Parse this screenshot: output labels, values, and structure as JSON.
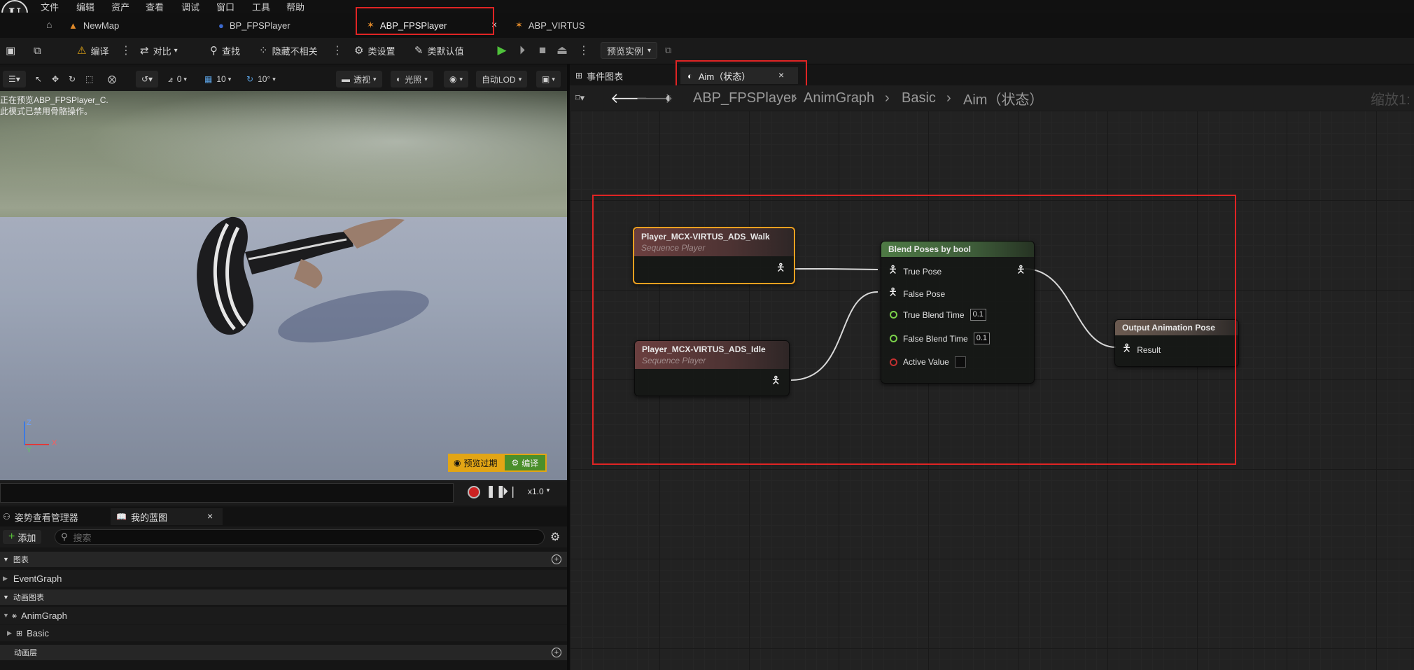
{
  "menu": [
    "文件",
    "编辑",
    "资产",
    "查看",
    "调试",
    "窗口",
    "工具",
    "帮助"
  ],
  "doc_tabs": [
    {
      "label": "NewMap"
    },
    {
      "label": "BP_FPSPlayer"
    },
    {
      "label": "ABP_FPSPlayer",
      "active": true
    },
    {
      "label": "ABP_VIRTUS"
    }
  ],
  "toolbar": {
    "compile": "编译",
    "diff": "对比",
    "find": "查找",
    "hide_unrelated": "隐藏不相关",
    "class_settings": "类设置",
    "class_defaults": "类默认值",
    "preview_instance": "预览实例"
  },
  "viewport_toolbar": {
    "rot_value": "0",
    "grid_value": "10",
    "angle_value": "10°",
    "perspective": "透视",
    "lighting": "光照",
    "auto_lod": "自动LOD"
  },
  "viewport": {
    "overlay_line1": "正在预览ABP_FPSPlayer_C.",
    "overlay_line2": "此模式已禁用骨骼操作。",
    "axis_z": "Z",
    "axis_x": "X",
    "axis_y": "Y",
    "preview_outdated": "预览过期",
    "compile": "编译"
  },
  "playback": {
    "speed": "x1.0"
  },
  "my_blueprint": {
    "tabs": [
      "姿势查看管理器",
      "我的蓝图"
    ],
    "add": "添加",
    "search_placeholder": "搜索",
    "sections": [
      {
        "label": "图表",
        "items": [
          "EventGraph"
        ]
      },
      {
        "label": "动画图表",
        "items": [
          "AnimGraph",
          "Basic"
        ]
      },
      {
        "label": "动画层",
        "items": []
      }
    ]
  },
  "graph_editor": {
    "tabs": [
      "事件图表",
      "Aim（状态）"
    ],
    "breadcrumb": [
      "ABP_FPSPlayer",
      "AnimGraph",
      "Basic",
      "Aim（状态）"
    ],
    "zoom": "缩放1:"
  },
  "nodes": {
    "walk": {
      "title": "Player_MCX-VIRTUS_ADS_Walk",
      "subtitle": "Sequence Player"
    },
    "idle": {
      "title": "Player_MCX-VIRTUS_ADS_Idle",
      "subtitle": "Sequence Player"
    },
    "blend": {
      "title": "Blend Poses by bool",
      "true_pose": "True Pose",
      "false_pose": "False Pose",
      "true_blend_time": "True Blend Time",
      "true_blend_value": "0.1",
      "false_blend_time": "False Blend Time",
      "false_blend_value": "0.1",
      "active_value": "Active Value"
    },
    "output": {
      "title": "Output Animation Pose",
      "result": "Result"
    }
  },
  "colors": {
    "highlight_red": "#e02424",
    "selected_node_outline": "#f0a020",
    "play_green": "#4fc23b",
    "bool_pin_red": "#c23030",
    "float_pin_green": "#7ad04a"
  }
}
